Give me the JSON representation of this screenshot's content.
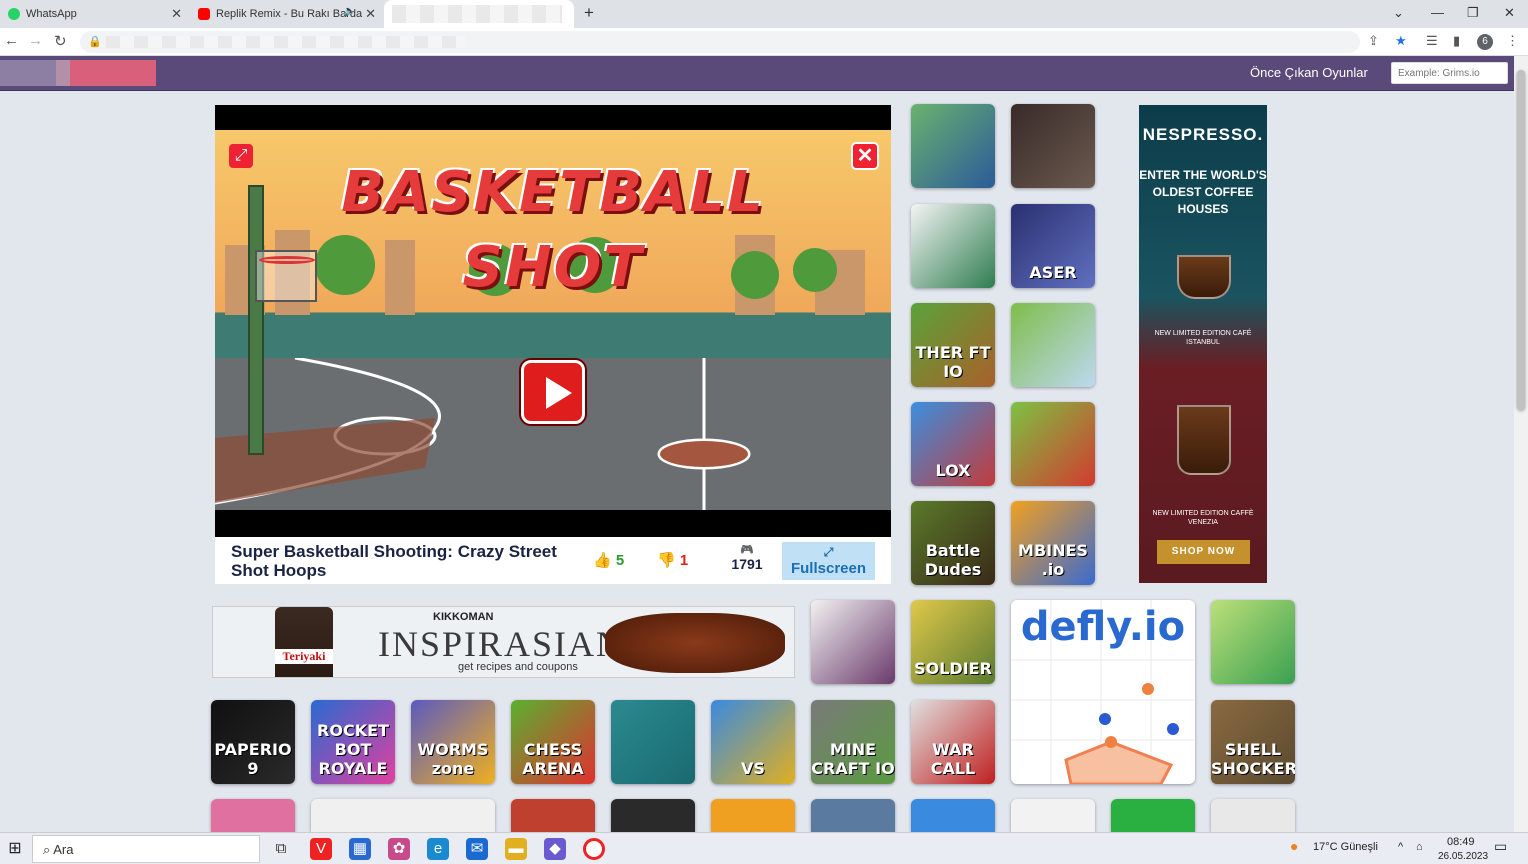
{
  "browser": {
    "tabs": [
      {
        "title": "WhatsApp",
        "icon": "whatsapp-icon",
        "color": "#25d366"
      },
      {
        "title": "Replik Remix - Bu Rakı Barda",
        "icon": "youtube-icon",
        "color": "#ff0000"
      },
      {
        "title": "",
        "icon": "blurred",
        "color": "#cccccc"
      }
    ],
    "new_tab": "+"
  },
  "site": {
    "featured_label": "Önce Çıkan Oyunlar",
    "search_placeholder": "Example: Grims.io"
  },
  "player": {
    "title_line1": "BASKETBALL",
    "title_line2": "SHOT",
    "game_title": "Super Basketball Shooting: Crazy Street Shot Hoops",
    "likes": "5",
    "dislikes": "1",
    "plays": "1791",
    "fullscreen_label": "Fullscreen"
  },
  "side_thumbs": [
    {
      "label": "",
      "colors": [
        "#6bb26f",
        "#2b5b99"
      ]
    },
    {
      "label": "",
      "colors": [
        "#3a2a28",
        "#6a5a50"
      ]
    },
    {
      "label": "",
      "colors": [
        "#f4f4f4",
        "#2e7d4f"
      ]
    },
    {
      "label": "ASER",
      "colors": [
        "#2a3070",
        "#6070c0"
      ]
    },
    {
      "label": "THER FT IO",
      "colors": [
        "#5aa33a",
        "#a9602a"
      ]
    },
    {
      "label": "",
      "colors": [
        "#7fbd4a",
        "#bcd9f0"
      ]
    },
    {
      "label": "LOX",
      "colors": [
        "#3b8fe0",
        "#c23b3b"
      ]
    },
    {
      "label": "",
      "colors": [
        "#7cc242",
        "#d23b30"
      ]
    },
    {
      "label": "Battle Dudes",
      "colors": [
        "#5a7a2a",
        "#3a2a18"
      ]
    },
    {
      "label": "MBINES .io",
      "colors": [
        "#f2a020",
        "#3a6ad0"
      ]
    }
  ],
  "grid_thumbs": [
    {
      "label": "",
      "colors": [
        "#f2f2f2",
        "#6a3a6a"
      ]
    },
    {
      "label": "SOLDIER",
      "colors": [
        "#e0c84a",
        "#5a7a30"
      ]
    },
    {
      "label": "",
      "colors": [
        "#bce07a",
        "#3aa050"
      ]
    },
    {
      "label": "PAPERIO 9",
      "colors": [
        "#101010",
        "#2a2a2a"
      ]
    },
    {
      "label": "ROCKET BOT ROYALE",
      "colors": [
        "#2a6ad0",
        "#e040a0"
      ]
    },
    {
      "label": "WORMS zone",
      "colors": [
        "#5a5ac0",
        "#f0b020"
      ]
    },
    {
      "label": "CHESS ARENA",
      "colors": [
        "#5ab030",
        "#e03030"
      ]
    },
    {
      "label": "",
      "colors": [
        "#2a8a90",
        "#1a6a70"
      ]
    },
    {
      "label": "VS",
      "colors": [
        "#3a8ae0",
        "#e0b020"
      ]
    },
    {
      "label": "MINE CRAFT IO",
      "colors": [
        "#7a7a7a",
        "#5a9a40"
      ]
    },
    {
      "label": "WAR CALL",
      "colors": [
        "#e0e0e0",
        "#c02020"
      ]
    },
    {
      "label": "SHELL SHOCKERS",
      "colors": [
        "#8a6a40",
        "#5a4a30"
      ]
    }
  ],
  "defly": {
    "text": "defly.io"
  },
  "ads": {
    "right": {
      "brand": "NESPRESSO.",
      "headline": "ENTER THE WORLD'S OLDEST COFFEE HOUSES",
      "edition1": "NEW LIMITED EDITION CAFÉ ISTANBUL",
      "edition2": "NEW LIMITED EDITION CAFFÈ VENEZIA",
      "cta": "SHOP NOW"
    },
    "bottom": {
      "brand": "KIKKOMAN",
      "headline": "INSPIRASIAN",
      "sub": "get recipes and coupons",
      "bottle_label": "Teriyaki"
    }
  },
  "taskbar": {
    "search": "Ara",
    "weather": "17°C  Güneşli",
    "time": "08:49",
    "date": "26.05.2023"
  }
}
